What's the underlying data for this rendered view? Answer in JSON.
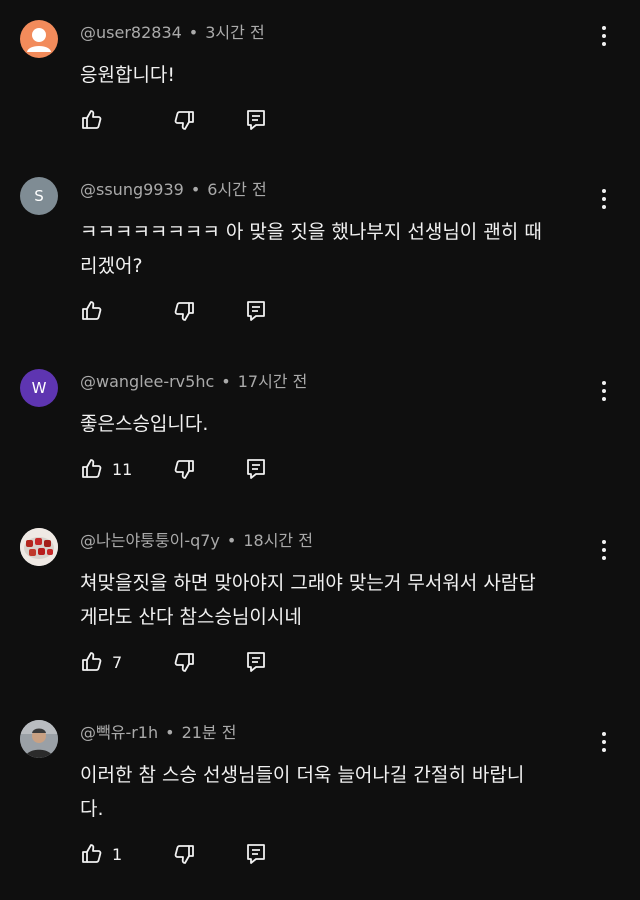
{
  "comments": [
    {
      "handle": "@user82834",
      "time": "3시간 전",
      "lines": [
        "응원합니다!"
      ],
      "likes": "",
      "avatar": {
        "kind": "default-person-icon",
        "bg": "#f28b5b"
      }
    },
    {
      "handle": "@ssung9939",
      "time": "6시간 전",
      "lines": [
        "ㅋㅋㅋㅋㅋㅋㅋㅋ 아 맞을 짓을 했나부지 선생님이 괜히 때",
        "리겠어?"
      ],
      "likes": "",
      "avatar": {
        "kind": "letter",
        "letter": "S",
        "bg": "#7f8c94"
      }
    },
    {
      "handle": "@wanglee-rv5hc",
      "time": "17시간 전",
      "lines": [
        "좋은스승입니다."
      ],
      "likes": "11",
      "avatar": {
        "kind": "letter",
        "letter": "W",
        "bg": "#5e35b1"
      }
    },
    {
      "handle": "@나는야퉁퉁이-q7y",
      "time": "18시간 전",
      "lines": [
        "쳐맞을짓을 하면 맞아야지 그래야 맞는거 무서워서 사람답",
        "게라도 산다 참스승님이시네"
      ],
      "likes": "7",
      "avatar": {
        "kind": "photo-food",
        "bg": "#e8e8e8"
      }
    },
    {
      "handle": "@빽유-r1h",
      "time": "21분 전",
      "lines": [
        "이러한 참 스승 선생님들이 더욱 늘어나길 간절히 바랍니",
        "다."
      ],
      "likes": "1",
      "avatar": {
        "kind": "photo-person",
        "bg": "#8a8f95"
      }
    }
  ],
  "icons": {
    "like": "thumbs-up-icon",
    "dislike": "thumbs-down-icon",
    "reply": "reply-comment-icon",
    "more": "more-vertical-icon"
  },
  "colors": {
    "background": "#0f0f0f",
    "text": "#f1f1f1",
    "meta": "#aaaaaa"
  }
}
